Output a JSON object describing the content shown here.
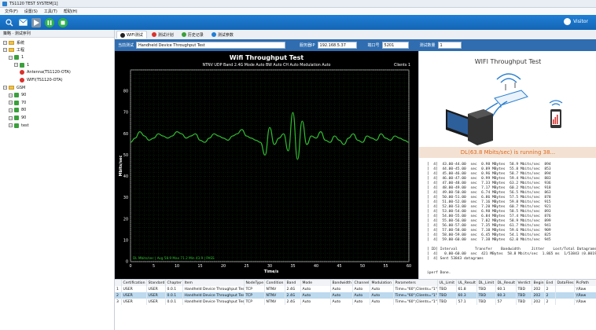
{
  "window": {
    "title": "TS1120 TEST SYSTEM[1]"
  },
  "menu": [
    "文件(F)",
    "设置(S)",
    "工具(T)",
    "帮助(H)"
  ],
  "toolbar": {
    "user": "Visitor"
  },
  "sidebar": {
    "header": "策略 · 测试序列",
    "items": [
      {
        "label": "系统",
        "kind": "folder",
        "indent": 0
      },
      {
        "label": "工程",
        "kind": "folder",
        "indent": 0
      },
      {
        "label": "1",
        "kind": "green",
        "indent": 1
      },
      {
        "label": "1",
        "kind": "green",
        "indent": 2
      },
      {
        "label": "Antenna(TS1120-OTA)",
        "kind": "red",
        "indent": 3
      },
      {
        "label": "WIFI(TS1120-OTA)",
        "kind": "red",
        "indent": 3
      },
      {
        "label": "GSM",
        "kind": "folder",
        "indent": 0
      },
      {
        "label": "90",
        "kind": "green",
        "indent": 1
      },
      {
        "label": "70",
        "kind": "green",
        "indent": 1
      },
      {
        "label": "80",
        "kind": "green",
        "indent": 1
      },
      {
        "label": "90",
        "kind": "green",
        "indent": 1
      },
      {
        "label": "test",
        "kind": "green",
        "indent": 1
      }
    ]
  },
  "tabs": [
    {
      "label": "WIFI测试",
      "color": "#222",
      "active": true
    },
    {
      "label": "测试计划",
      "color": "#d8322e",
      "active": false
    },
    {
      "label": "历史记录",
      "color": "#3aa03c",
      "active": false
    },
    {
      "label": "测试参数",
      "color": "#1f7fd6",
      "active": false
    }
  ],
  "infobar": {
    "item_label": "当前测试",
    "item_value": "Handheld Device Throughput Test",
    "ip_label": "服务器IP",
    "ip_value": "192.168.5.37",
    "port_label": "端口号",
    "port_value": "5201",
    "count_label": "测试数量",
    "count_value": "1"
  },
  "chart_data": {
    "type": "line",
    "title": "Wifi Throughput Test",
    "subtitle": "NTNV  UDP  Band 2.4G  Mode Auto  BW Auto  CH Auto  Modulation Auto",
    "clients": "Clients 1",
    "xlabel": "Time/s",
    "ylabel": "Mbits/sec",
    "xlim": [
      0,
      60
    ],
    "ylim": [
      0,
      90
    ],
    "xticks": [
      0,
      5,
      10,
      15,
      20,
      25,
      30,
      35,
      40,
      45,
      50,
      55,
      60
    ],
    "yticks": [
      0,
      10,
      20,
      30,
      40,
      50,
      60,
      70,
      80
    ],
    "legend": "DL Mbits/sec | Avg 58.9  Max 71.2  Min 43.9 | PASS",
    "series": [
      {
        "color": "#2fbf2f",
        "x": [
          0,
          1,
          2,
          3,
          4,
          5,
          6,
          7,
          8,
          9,
          10,
          11,
          12,
          13,
          14,
          15,
          16,
          17,
          18,
          19,
          20,
          21,
          22,
          23,
          24,
          25,
          26,
          27,
          28,
          29,
          30,
          31,
          32,
          33,
          34,
          35,
          36,
          37,
          38,
          39,
          40,
          41,
          42,
          43,
          44,
          45,
          46,
          47,
          48,
          49,
          50,
          51,
          52,
          53,
          54,
          55,
          56,
          57,
          58,
          59,
          60
        ],
        "y": [
          56,
          58,
          61,
          59,
          57,
          58,
          60,
          59,
          58,
          59,
          61,
          60,
          58,
          59,
          60,
          57,
          56,
          58,
          60,
          59,
          58,
          57,
          59,
          60,
          62,
          59,
          58,
          57,
          56,
          50,
          63,
          55,
          58,
          60,
          52,
          70,
          48,
          66,
          55,
          59,
          58,
          61,
          57,
          56,
          59,
          57,
          55,
          58,
          60,
          57,
          56,
          59,
          58,
          57,
          60,
          58,
          57,
          59,
          58,
          57,
          56
        ]
      }
    ]
  },
  "right": {
    "title": "WIFI Throughput Test",
    "status": "DL(63.8 Mbits/sec) is running 38...",
    "log": [
      "[  4]  43.00-44.00  sec  0.98 MBytes  58.9 Mbits/sec  894",
      "[  4]  44.00-45.00  sec  0.89 MBytes  55.8 Mbits/sec  853",
      "[  4]  45.00-46.00  sec  0.96 MBytes  58.7 Mbits/sec  894",
      "[  4]  46.00-47.00  sec  0.99 MBytes  59.4 Mbits/sec  883",
      "[  4]  47.00-48.00  sec  7.33 MBytes  63.2 Mbits/sec  936",
      "[  4]  48.00-49.00  sec  7.17 MBytes  60.2 Mbits/sec  918",
      "[  4]  49.00-50.00  sec  6.74 MBytes  56.5 Mbits/sec  863",
      "[  4]  50.00-51.00  sec  6.86 MBytes  57.5 Mbits/sec  878",
      "[  4]  51.00-52.00  sec  7.16 MBytes  59.8 Mbits/sec  915",
      "[  4]  52.00-53.00  sec  7.20 MBytes  60.7 Mbits/sec  921",
      "[  4]  53.00-54.00  sec  6.98 MBytes  58.5 Mbits/sec  893",
      "[  4]  54.00-55.00  sec  6.84 MBytes  57.4 Mbits/sec  876",
      "[  4]  55.00-56.00  sec  7.02 MBytes  58.9 Mbits/sec  899",
      "[  4]  56.00-57.00  sec  7.35 MBytes  61.7 Mbits/sec  941",
      "[  4]  57.00-58.00  sec  7.10 MBytes  59.6 Mbits/sec  909",
      "[  4]  58.00-59.00  sec  6.45 MBytes  54.1 Mbits/sec  825",
      "[  4]  59.00-60.00  sec  7.38 MBytes  62.0 Mbits/sec  945",
      "",
      "[ ID] Interval        Transfer    Bandwidth     Jitter    Lost/Total Datagrams",
      "[  4]   0.00-60.00  sec  421 MBytes  58.8 Mbits/sec  1.865 ms  1/53843 (0.0019%)",
      "[  4] Sent 53843 datagrams",
      "",
      "",
      "iperf Done."
    ]
  },
  "table": {
    "headers": [
      "",
      "Certification",
      "Standard",
      "Chapter",
      "Item",
      "NodeType",
      "Condition",
      "Band",
      "Mode",
      "Bandwidth",
      "Channel",
      "Modulation",
      "Parameters",
      "UL_Limit",
      "UL_Result",
      "DL_Limit",
      "DL_Result",
      "Verdict",
      "Begin",
      "End",
      "DataFiles",
      "PicPath"
    ],
    "rows": [
      [
        "1",
        "USER",
        "USER",
        "0.0.1",
        "Handheld Device Throughput Test",
        "TCP",
        "NTNV",
        "2.4G",
        "Auto",
        "Auto",
        "Auto",
        "Auto",
        "Time=\"60\";Clients=\"1\"",
        "TBD",
        "61.8",
        "TBD",
        "60.1",
        "TBD",
        "202",
        "2",
        "",
        "\\\\Raw"
      ],
      [
        "2",
        "USER",
        "USER",
        "0.0.1",
        "Handheld Device Throughput Test",
        "TCP",
        "NTNV",
        "2.4G",
        "Auto",
        "Auto",
        "Auto",
        "Auto",
        "Time=\"60\";Clients=\"1\"",
        "TBD",
        "60.3",
        "TBD",
        "60.3",
        "TBD",
        "202",
        "2",
        "",
        "\\\\Raw"
      ],
      [
        "3",
        "USER",
        "USER",
        "0.0.1",
        "Handheld Device Throughput Test",
        "TCP",
        "NTNV",
        "2.4G",
        "Auto",
        "Auto",
        "Auto",
        "Auto",
        "Time=\"60\";Clients=\"1\"",
        "TBD",
        "57.1",
        "TBD",
        "57",
        "TBD",
        "202",
        "2",
        "",
        "\\\\Raw"
      ]
    ]
  }
}
